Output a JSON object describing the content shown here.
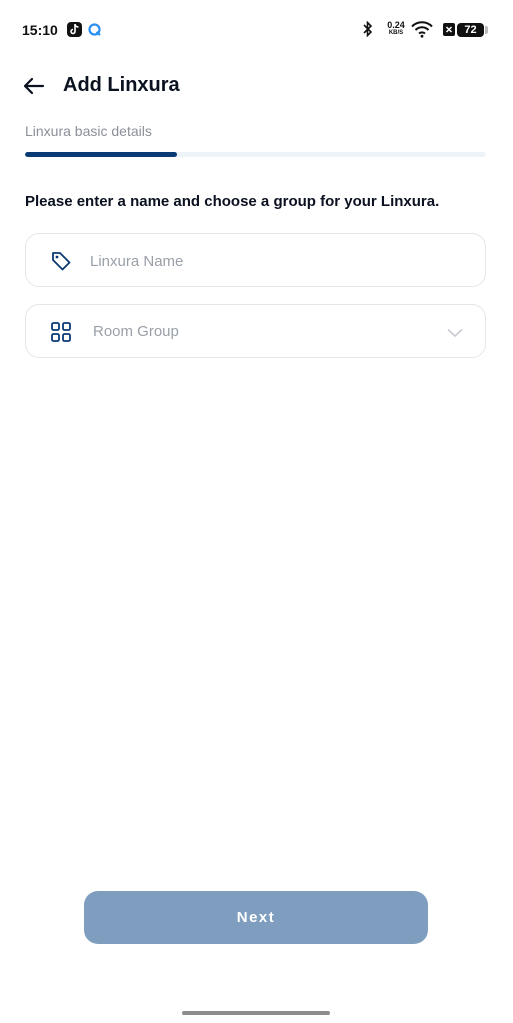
{
  "status_bar": {
    "time": "15:10",
    "net_speed": "0.24",
    "net_unit": "KB/S",
    "battery": "72",
    "icons": [
      "tiktok-icon",
      "qq-icon",
      "bluetooth-icon",
      "wifi-icon",
      "x-icon",
      "battery-icon"
    ]
  },
  "header": {
    "back_icon": "arrow-left-icon",
    "title": "Add Linxura"
  },
  "step": {
    "label": "Linxura basic details",
    "progress": 0.33
  },
  "instruction": "Please enter a name and choose a group for your Linxura.",
  "fields": {
    "name": {
      "placeholder": "Linxura Name",
      "value": "",
      "icon": "tag-icon"
    },
    "group": {
      "placeholder": "Room Group",
      "icon": "grid-icon",
      "dropdown_icon": "chevron-down-icon"
    }
  },
  "actions": {
    "next_label": "Next"
  },
  "colors": {
    "primary": "#0a3a74",
    "button_disabled": "#7f9ebf",
    "field_border": "#e3e6ea",
    "muted_text": "#9aa0a8"
  }
}
